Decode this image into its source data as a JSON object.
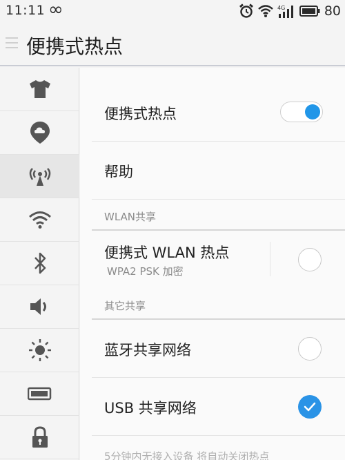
{
  "status_bar": {
    "time": "11:11",
    "infinity_icon": "∞",
    "battery_level": "80",
    "net_label": "4G"
  },
  "app_bar": {
    "title": "便携式热点"
  },
  "sidebar": {
    "items": [
      {
        "icon": "tshirt-icon",
        "active": false
      },
      {
        "icon": "cloud-location-icon",
        "active": false
      },
      {
        "icon": "hotspot-icon",
        "active": true
      },
      {
        "icon": "wifi-icon",
        "active": false
      },
      {
        "icon": "bluetooth-icon",
        "active": false
      },
      {
        "icon": "volume-icon",
        "active": false
      },
      {
        "icon": "brightness-icon",
        "active": false
      },
      {
        "icon": "battery-icon",
        "active": false
      },
      {
        "icon": "lock-icon",
        "active": false
      }
    ]
  },
  "main": {
    "hotspot_row": {
      "label": "便携式热点",
      "enabled": true
    },
    "help_row": {
      "label": "帮助"
    },
    "wlan_section": {
      "label": "WLAN共享"
    },
    "wlan_row": {
      "label": "便携式 WLAN 热点",
      "sub": "WPA2 PSK 加密",
      "checked": false
    },
    "other_section": {
      "label": "其它共享"
    },
    "bt_row": {
      "label": "蓝牙共享网络",
      "checked": false
    },
    "usb_row": {
      "label": "USB 共享网络",
      "checked": true
    },
    "footer_note": "5分钟内无接入设备 将自动关闭热点"
  },
  "colors": {
    "accent": "#2196e8",
    "background": "#f4f4f4"
  }
}
